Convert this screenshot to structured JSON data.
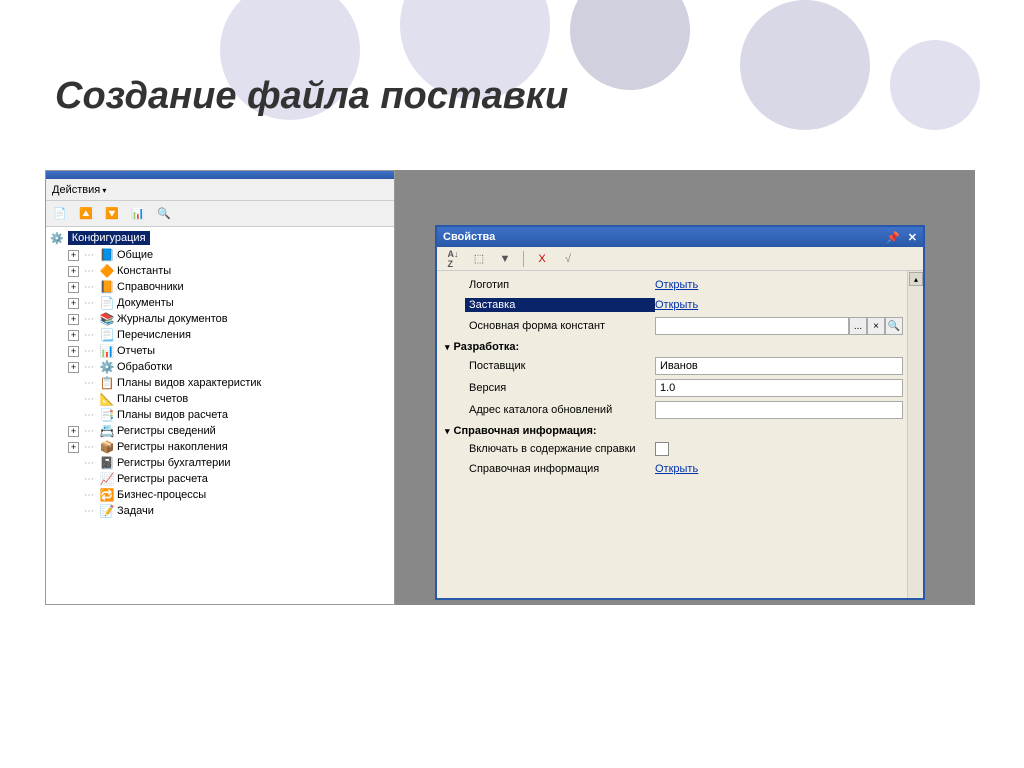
{
  "slide": {
    "title": "Создание файла поставки"
  },
  "tree": {
    "menu_label": "Действия",
    "root": "Конфигурация",
    "items": [
      {
        "label": "Общие",
        "expand": true
      },
      {
        "label": "Константы",
        "expand": true
      },
      {
        "label": "Справочники",
        "expand": true
      },
      {
        "label": "Документы",
        "expand": true
      },
      {
        "label": "Журналы документов",
        "expand": true
      },
      {
        "label": "Перечисления",
        "expand": true
      },
      {
        "label": "Отчеты",
        "expand": true
      },
      {
        "label": "Обработки",
        "expand": true
      },
      {
        "label": "Планы видов характеристик",
        "expand": false
      },
      {
        "label": "Планы счетов",
        "expand": false
      },
      {
        "label": "Планы видов расчета",
        "expand": false
      },
      {
        "label": "Регистры сведений",
        "expand": true
      },
      {
        "label": "Регистры накопления",
        "expand": true
      },
      {
        "label": "Регистры бухгалтерии",
        "expand": false
      },
      {
        "label": "Регистры расчета",
        "expand": false
      },
      {
        "label": "Бизнес-процессы",
        "expand": false
      },
      {
        "label": "Задачи",
        "expand": false
      }
    ]
  },
  "props": {
    "title": "Свойства",
    "rows": {
      "logo": {
        "label": "Логотип",
        "action": "Открыть"
      },
      "splash": {
        "label": "Заставка",
        "action": "Открыть"
      },
      "main_form": {
        "label": "Основная форма констант"
      },
      "section_dev": "Разработка:",
      "vendor": {
        "label": "Поставщик",
        "value": "Иванов"
      },
      "version": {
        "label": "Версия",
        "value": "1.0"
      },
      "update_url": {
        "label": "Адрес каталога обновлений",
        "value": ""
      },
      "section_help": "Справочная информация:",
      "include_help": {
        "label": "Включать в содержание справки"
      },
      "help_info": {
        "label": "Справочная информация",
        "action": "Открыть"
      }
    },
    "input_buttons": {
      "ellipsis": "...",
      "clear": "×",
      "search": "🔍"
    }
  }
}
